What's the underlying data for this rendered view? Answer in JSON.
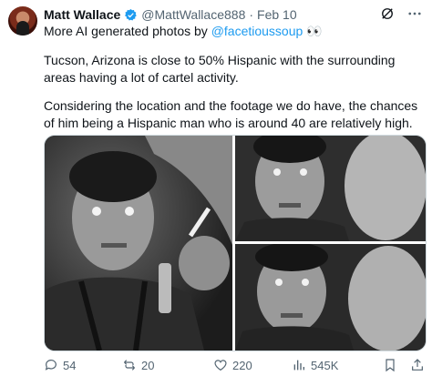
{
  "post": {
    "author_name": "Matt Wallace",
    "handle": "@MattWallace888",
    "separator": "·",
    "date": "Feb 10",
    "intro_text": "More AI generated photos by ",
    "mention": "@facetioussoup",
    "intro_emoji": "👀",
    "paragraph1": "Tucson, Arizona is close to 50% Hispanic with the surrounding areas having a lot of cartel activity.",
    "paragraph2": "Considering the location and the footage we do have, the chances of him being a Hispanic man who is around 40 are relatively high."
  },
  "media": {
    "images": [
      {
        "icon": "grayscale-photo-man-smoking"
      },
      {
        "icon": "grayscale-photo-man-closeup"
      },
      {
        "icon": "grayscale-photo-man-closeup"
      }
    ]
  },
  "footer": {
    "replies": "54",
    "retweets": "20",
    "likes": "220",
    "views": "545K"
  },
  "colors": {
    "accent": "#1d9bf0",
    "secondary_text": "#536471",
    "primary_text": "#0f1419"
  }
}
